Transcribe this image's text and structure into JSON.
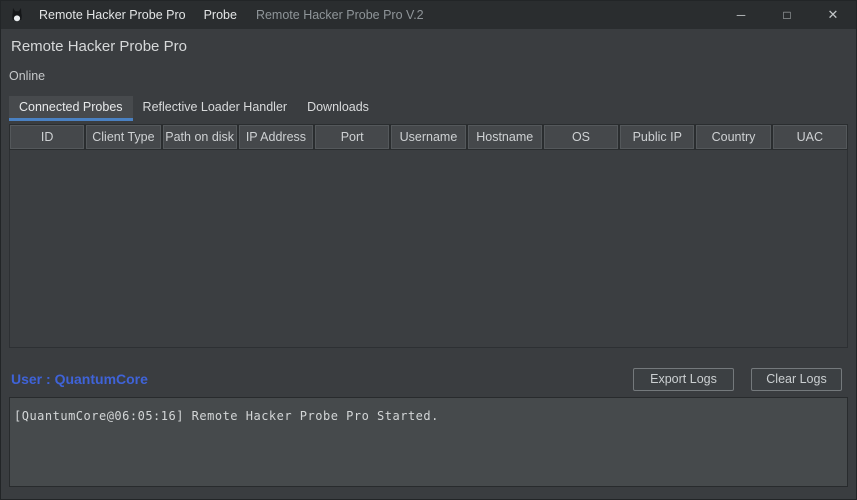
{
  "titlebar": {
    "menu_items": [
      "Remote Hacker Probe Pro",
      "Probe"
    ],
    "window_title": "Remote Hacker Probe Pro V.2",
    "controls": {
      "minimize": "─",
      "maximize": "□",
      "close": "✕"
    }
  },
  "header": {
    "title": "Remote Hacker Probe Pro",
    "status": "Online"
  },
  "tabs": {
    "items": [
      "Connected Probes",
      "Reflective Loader Handler",
      "Downloads"
    ],
    "active": "Connected Probes"
  },
  "table": {
    "columns": [
      "ID",
      "Client Type",
      "Path on disk",
      "IP Address",
      "Port",
      "Username",
      "Hostname",
      "OS",
      "Public IP",
      "Country",
      "UAC"
    ],
    "rows": []
  },
  "footer": {
    "user_label": "User : QuantumCore",
    "export_label": "Export Logs",
    "clear_label": "Clear Logs"
  },
  "log": {
    "lines": [
      "[QuantumCore@06:05:16] Remote Hacker Probe Pro Started."
    ]
  },
  "colors": {
    "accent_tab_underline": "#4a81c2",
    "user_label_blue": "#3f63d8",
    "titlebar_bg": "#2a2d2f",
    "window_bg": "#3a3d40",
    "log_bg": "#464a4c"
  }
}
